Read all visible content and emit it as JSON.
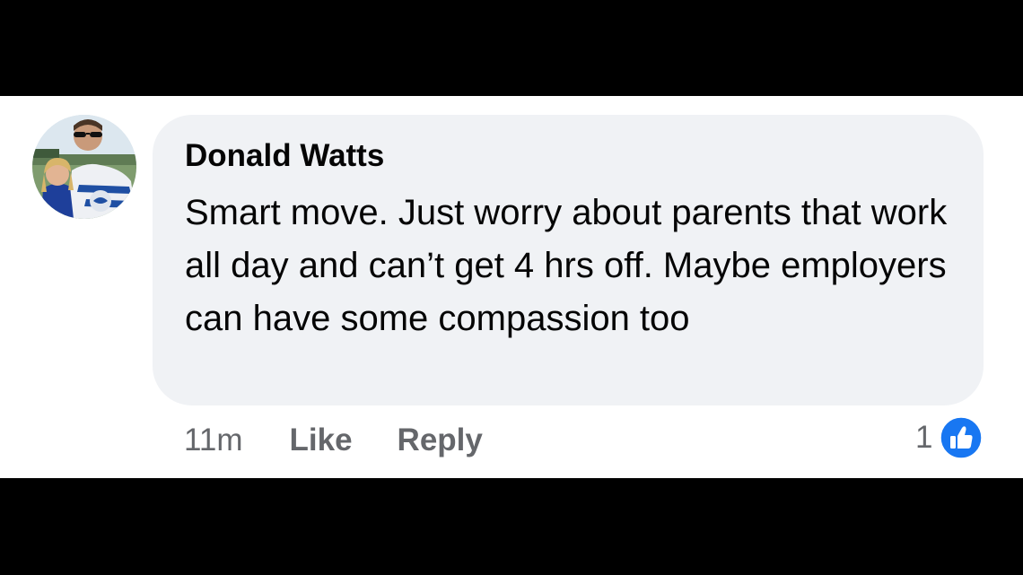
{
  "comment": {
    "author": "Donald Watts",
    "text": "Smart move. Just worry about parents that work all day and can’t get 4 hrs off. Maybe employers can have some compassion too",
    "timestamp": "11m",
    "like_label": "Like",
    "reply_label": "Reply",
    "reaction_count": "1",
    "reaction_icon": "thumbs-up-icon",
    "avatar_icon": "profile-photo"
  },
  "colors": {
    "background": "#000000",
    "panel": "#ffffff",
    "bubble": "#f0f2f5",
    "text": "#050505",
    "secondary_text": "#65676b",
    "like_blue": "#1877f2"
  }
}
